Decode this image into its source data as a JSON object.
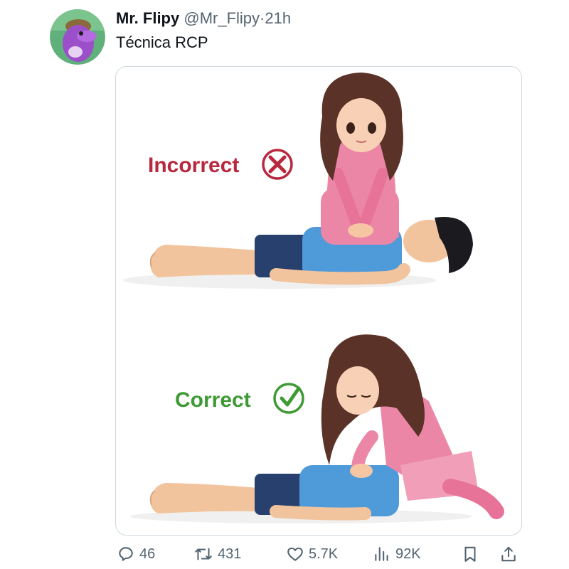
{
  "post": {
    "author_name": "Mr. Flipy",
    "author_handle": "@Mr_Flipy",
    "separator": "·",
    "time": "21h",
    "text": "Técnica RCP"
  },
  "media": {
    "label_incorrect": "Incorrect",
    "label_correct": "Correct",
    "colors": {
      "incorrect": "#b8283f",
      "correct": "#3f9a35"
    }
  },
  "actions": {
    "replies": "46",
    "reposts": "431",
    "likes": "5.7K",
    "views": "92K"
  },
  "icons": [
    "avatar-dolphin",
    "reply-icon",
    "repost-icon",
    "like-icon",
    "views-icon",
    "bookmark-icon",
    "share-icon",
    "x-circle-icon",
    "check-circle-icon"
  ]
}
